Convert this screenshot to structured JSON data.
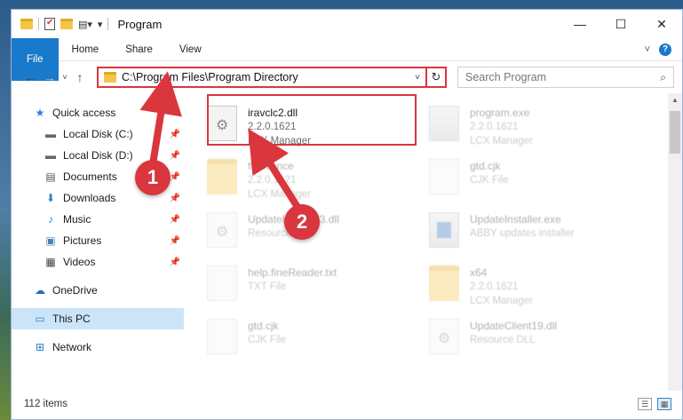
{
  "window": {
    "title": "Program",
    "controls": {
      "minimize": "—",
      "maximize": "☐",
      "close": "✕"
    }
  },
  "ribbon": {
    "tabs": [
      "File",
      "Home",
      "Share",
      "View"
    ],
    "expand_icon": "˅",
    "help_icon": "?"
  },
  "addressbar": {
    "path": "C:\\Program Files\\Program Directory",
    "search_placeholder": "Search Program",
    "back": "←",
    "forward": "→",
    "recent": "˅",
    "up": "↑",
    "dropdown": "˅",
    "refresh": "↻",
    "search_glyph": "⌕"
  },
  "sidebar": {
    "quick_access": "Quick access",
    "items": [
      {
        "label": "Local Disk (C:)",
        "icon": "drive-icon",
        "pinned": true
      },
      {
        "label": "Local Disk (D:)",
        "icon": "drive-icon",
        "pinned": true
      },
      {
        "label": "Documents",
        "icon": "documents-icon",
        "pinned": true
      },
      {
        "label": "Downloads",
        "icon": "downloads-icon",
        "pinned": true
      },
      {
        "label": "Music",
        "icon": "music-icon",
        "pinned": true
      },
      {
        "label": "Pictures",
        "icon": "pictures-icon",
        "pinned": true
      },
      {
        "label": "Videos",
        "icon": "videos-icon",
        "pinned": true
      }
    ],
    "onedrive": "OneDrive",
    "this_pc": "This PC",
    "network": "Network"
  },
  "files": [
    {
      "name": "iravclc2.dll",
      "line2": "2.2.0.1621",
      "line3": "LCX Manager",
      "type": "dll",
      "highlighted": true
    },
    {
      "name": "program.exe",
      "line2": "2.2.0.1621",
      "line3": "LCX Manager",
      "type": "exe"
    },
    {
      "name": "ffadvance",
      "line2": "2.2.0.1621",
      "line3": "LCX Manager",
      "type": "folder"
    },
    {
      "name": "gtd.cjk",
      "line2": "CJK File",
      "line3": "",
      "type": "doc"
    },
    {
      "name": "UpdateHelper63.dll",
      "line2": "Resource DLL",
      "line3": "",
      "type": "dll"
    },
    {
      "name": "UpdateInstaller.exe",
      "line2": "ABBY updates installer",
      "line3": "",
      "type": "exe-blue"
    },
    {
      "name": "help.fineReader.txt",
      "line2": "TXT File",
      "line3": "",
      "type": "doc"
    },
    {
      "name": "x64",
      "line2": "2.2.0.1621",
      "line3": "LCX Manager",
      "type": "folder"
    },
    {
      "name": "gtd.cjk",
      "line2": "CJK File",
      "line3": "",
      "type": "doc"
    },
    {
      "name": "UpdateClient19.dll",
      "line2": "Resource DLL",
      "line3": "",
      "type": "dll"
    }
  ],
  "status": {
    "item_count": "112 items"
  },
  "annotations": {
    "step1": "1",
    "step2": "2",
    "color": "#d9363e"
  }
}
